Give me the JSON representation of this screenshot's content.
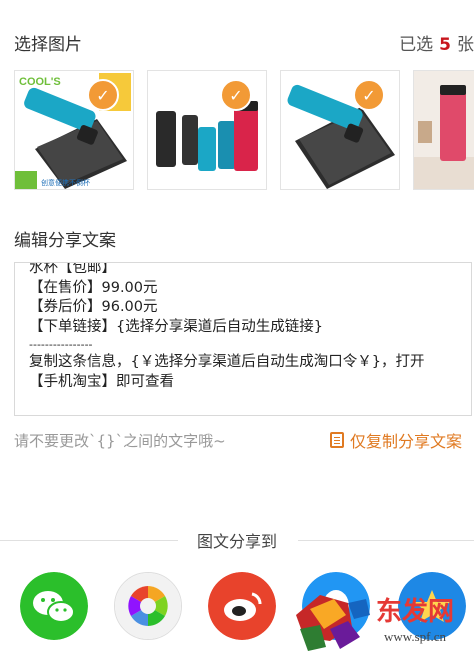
{
  "images": {
    "header": "选择图片",
    "selected_prefix": "已选",
    "selected_count": "5",
    "selected_suffix": "张",
    "check_icon": "✓",
    "thumb1_logo": "COOL'S",
    "thumb1_slogan": "创意便携不倒杯"
  },
  "editor": {
    "header": "编辑分享文案",
    "lines": [
      "水杯【包邮】",
      "【在售价】99.00元",
      "【券后价】96.00元",
      "【下单链接】{选择分享渠道后自动生成链接}",
      "----------------",
      "复制这条信息，{￥选择分享渠道后自动生成淘口令￥}，打开",
      "【手机淘宝】即可查看"
    ]
  },
  "hint": {
    "text": "请不要更改`{}`之间的文字哦~",
    "copy_label": "仅复制分享文案"
  },
  "share": {
    "title": "图文分享到",
    "items": [
      {
        "icon": "wechat-icon",
        "color": "#2bbf2b"
      },
      {
        "icon": "moments-icon",
        "color": "#f2f2f2"
      },
      {
        "icon": "weibo-icon",
        "color": "#e8432c"
      },
      {
        "icon": "qq-icon",
        "color": "#2196f3"
      },
      {
        "icon": "qzone-icon",
        "color": "#1e88e5"
      }
    ]
  },
  "watermark": {
    "text": "东发网",
    "url": "www.spf.cn"
  }
}
